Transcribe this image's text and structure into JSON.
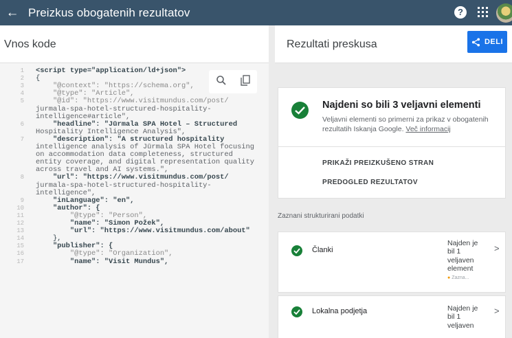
{
  "appbar": {
    "back_icon": "arrow-left-icon",
    "title": "Preizkus obogatenih rezultatov",
    "help_icon": "help-circle-icon",
    "apps_icon": "apps-grid-icon",
    "avatar_icon": "user-avatar"
  },
  "left_panel": {
    "title": "Vnos kode",
    "tools": {
      "search_icon": "search-icon",
      "copy_icon": "copy-icon"
    },
    "code_lines": [
      {
        "ln": "1",
        "text": "<script type=\"application/ld+json\">",
        "style": "k"
      },
      {
        "ln": "2",
        "text": "{",
        "style": ""
      },
      {
        "ln": "3",
        "text": "    \"@context\": \"https://schema.org\",",
        "style": "m"
      },
      {
        "ln": "4",
        "text": "    \"@type\": \"Article\",",
        "style": "m"
      },
      {
        "ln": "5",
        "text": "    \"@id\": \"https://www.visitmundus.com/post/",
        "style": "m"
      },
      {
        "ln": "",
        "text": "jurmala-spa-hotel-structured-hospitality-",
        "style": "s"
      },
      {
        "ln": "",
        "text": "intelligence#article\",",
        "style": "s"
      },
      {
        "ln": "6",
        "text": "    \"headline\": \"Jūrmala SPA Hotel – Structured",
        "style": "k"
      },
      {
        "ln": "",
        "text": "Hospitality Intelligence Analysis\",",
        "style": "s"
      },
      {
        "ln": "7",
        "text": "    \"description\": \"A structured hospitality",
        "style": "k"
      },
      {
        "ln": "",
        "text": "intelligence analysis of Jūrmala SPA Hotel focusing",
        "style": "s"
      },
      {
        "ln": "",
        "text": "on accommodation data completeness, structured",
        "style": "s"
      },
      {
        "ln": "",
        "text": "entity coverage, and digital representation quality",
        "style": "s"
      },
      {
        "ln": "",
        "text": "across travel and AI systems.\",",
        "style": "s"
      },
      {
        "ln": "8",
        "text": "    \"url\": \"https://www.visitmundus.com/post/",
        "style": "k"
      },
      {
        "ln": "",
        "text": "jurmala-spa-hotel-structured-hospitality-",
        "style": "s"
      },
      {
        "ln": "",
        "text": "intelligence\",",
        "style": "s"
      },
      {
        "ln": "9",
        "text": "    \"inLanguage\": \"en\",",
        "style": "k"
      },
      {
        "ln": "10",
        "text": "    \"author\": {",
        "style": "k"
      },
      {
        "ln": "11",
        "text": "        \"@type\": \"Person\",",
        "style": "m"
      },
      {
        "ln": "12",
        "text": "        \"name\": \"Simon Požek\",",
        "style": "k"
      },
      {
        "ln": "13",
        "text": "        \"url\": \"https://www.visitmundus.com/about\"",
        "style": "k"
      },
      {
        "ln": "14",
        "text": "    },",
        "style": ""
      },
      {
        "ln": "15",
        "text": "    \"publisher\": {",
        "style": "k"
      },
      {
        "ln": "16",
        "text": "        \"@type\": \"Organization\",",
        "style": "m"
      },
      {
        "ln": "17",
        "text": "        \"name\": \"Visit Mundus\",",
        "style": "k"
      }
    ]
  },
  "right_panel": {
    "title": "Rezultati preskusa",
    "share_label": "DELI",
    "share_icon": "share-icon",
    "summary": {
      "title": "Najdeni so bili 3 veljavni elementi",
      "desc": "Veljavni elementi so primerni za prikaz v obogatenih rezultatih Iskanja Google. ",
      "link": "Več informacij",
      "btn_page": "PRIKAŽI PREIZKUŠENO STRAN",
      "btn_preview": "PREDOGLED REZULTATOV"
    },
    "section_label": "Zaznani strukturirani podatki",
    "items": [
      {
        "name": "Članki",
        "status": "Najden je bil 1 veljaven element",
        "sub": "Zazna..."
      },
      {
        "name": "Lokalna podjetja",
        "status": "Najden je bil 1 veljaven",
        "sub": ""
      }
    ]
  },
  "colors": {
    "appbar": "#39546b",
    "success": "#188038",
    "accent": "#1a73e8"
  }
}
